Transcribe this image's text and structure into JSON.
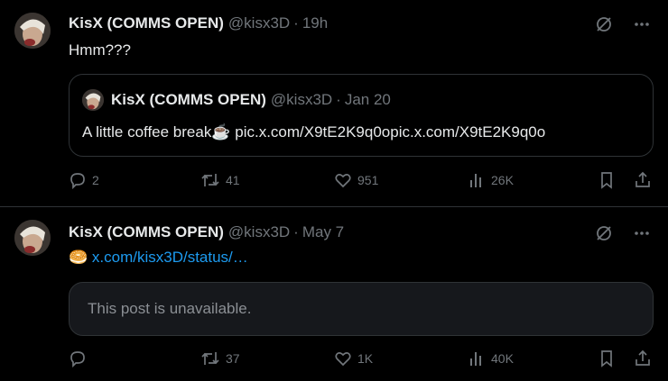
{
  "posts": [
    {
      "author_name": "KisX (COMMS OPEN)",
      "handle": "@kisx3D",
      "separator": "·",
      "time": "19h",
      "text": "Hmm???",
      "quote": {
        "author_name": "KisX (COMMS OPEN)",
        "handle": "@kisx3D",
        "separator": "·",
        "time": "Jan 20",
        "text": "A little coffee break",
        "emoji": "☕",
        "links": "pic.x.com/X9tE2K9q0opic.x.com/X9tE2K9q0o"
      },
      "stats": {
        "replies": "2",
        "reposts": "41",
        "likes": "951",
        "views": "26K"
      }
    },
    {
      "author_name": "KisX (COMMS OPEN)",
      "handle": "@kisx3D",
      "separator": "·",
      "time": "May 7",
      "emoji": "🥯",
      "link": "x.com/kisx3D/status/…",
      "unavailable_text": "This post is unavailable.",
      "stats": {
        "replies": "",
        "reposts": "37",
        "likes": "1K",
        "views": "40K"
      }
    }
  ],
  "colors": {
    "background": "#000000",
    "text": "#e7e9ea",
    "muted": "#71767b",
    "link": "#1d9bf0",
    "border": "#2f3336"
  },
  "icons": [
    "grok-icon",
    "more-icon",
    "reply-icon",
    "repost-icon",
    "like-icon",
    "views-icon",
    "bookmark-icon",
    "share-icon"
  ]
}
